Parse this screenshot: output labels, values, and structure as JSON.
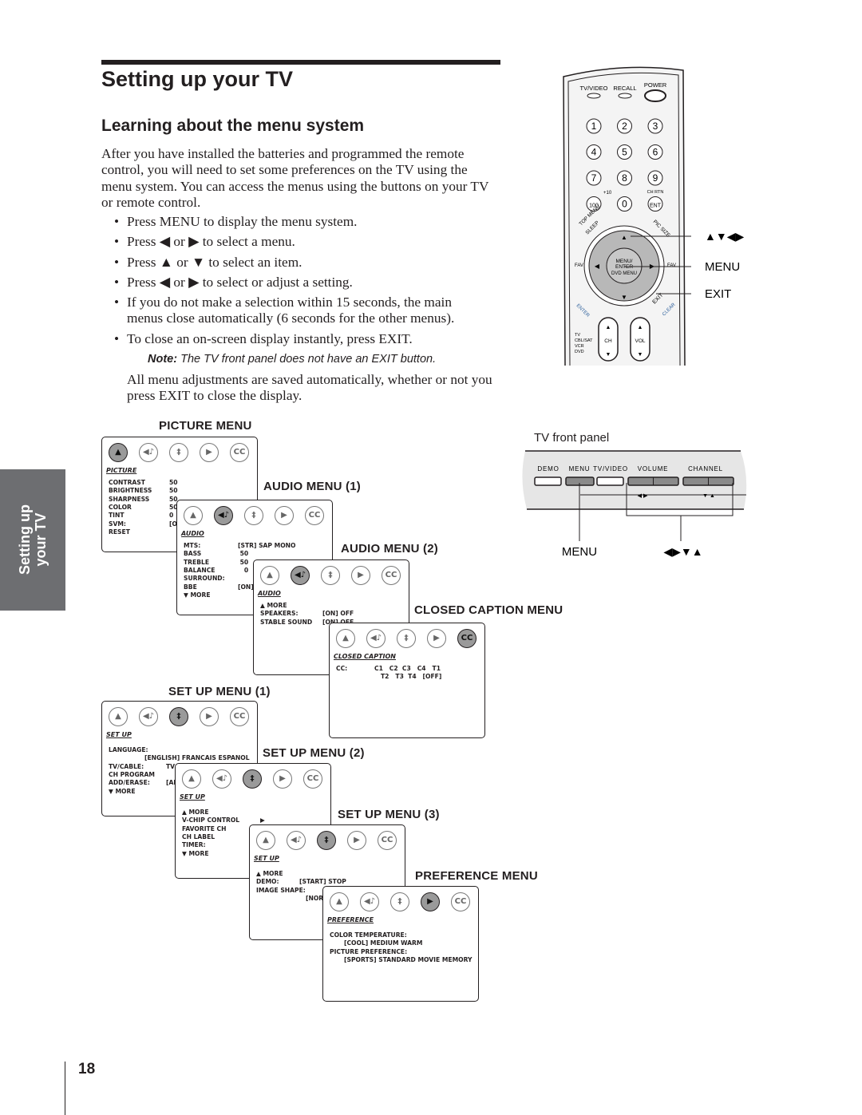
{
  "header": {
    "title": "Setting up your TV",
    "subtitle": "Learning about the menu system"
  },
  "intro": "After you have installed the batteries and programmed the remote control, you will need to set some preferences on the TV using the menu system. You can access the menus using the buttons on your TV or remote control.",
  "bullets": [
    "Press MENU to display the menu system.",
    "Press ◀ or ▶ to select a menu.",
    "Press ▲ or ▼ to select an item.",
    "Press ◀ or ▶ to select or adjust a setting.",
    "If you do not make a selection within 15 seconds, the main menus close automatically (6 seconds for the other menus).",
    "To close an on-screen display instantly, press EXIT."
  ],
  "note": {
    "label": "Note:",
    "text": " The TV front panel does not have an EXIT button."
  },
  "after": "All menu adjustments are saved automatically, whether or not you press EXIT to close the display.",
  "side_tab": {
    "line1": "Setting up",
    "line2": "your TV"
  },
  "page_number": "18",
  "menu_icons": [
    "picture-icon",
    "audio-icon",
    "setup-icon",
    "preference-icon",
    "closed-caption-icon"
  ],
  "menus": [
    {
      "title": "PICTURE MENU",
      "label": "PICTURE",
      "selected": 0,
      "rows": [
        {
          "label": "CONTRAST",
          "value": "50"
        },
        {
          "label": "BRIGHTNESS",
          "value": "50"
        },
        {
          "label": "SHARPNESS",
          "value": "50"
        },
        {
          "label": "COLOR",
          "value": "50"
        },
        {
          "label": "TINT",
          "value": "0"
        },
        {
          "label": "SVM:",
          "value": "[ON] OFF"
        },
        {
          "label": "RESET",
          "value": ""
        }
      ]
    },
    {
      "title": "AUDIO MENU (1)",
      "label": "AUDIO",
      "selected": 1,
      "rows": [
        {
          "label": "MTS:",
          "value": "[STR] SAP MONO"
        },
        {
          "label": "BASS",
          "value": " 50"
        },
        {
          "label": "TREBLE",
          "value": " 50"
        },
        {
          "label": "BALANCE",
          "value": "   0"
        },
        {
          "label": "SURROUND:",
          "value": ""
        },
        {
          "label": "BBE",
          "value": "[ON] OFF"
        },
        {
          "label": "▼ MORE",
          "value": ""
        }
      ]
    },
    {
      "title": "AUDIO MENU (2)",
      "label": "AUDIO",
      "selected": 1,
      "rows": [
        {
          "label": "▲ MORE",
          "value": ""
        },
        {
          "label": "SPEAKERS:",
          "value": "[ON] OFF"
        },
        {
          "label": "STABLE SOUND",
          "value": "[ON] OFF"
        }
      ]
    },
    {
      "title": "CLOSED CAPTION MENU",
      "label": "CLOSED CAPTION",
      "selected": 4,
      "rows": [
        {
          "label": "CC:",
          "value": "C1   C2  C3   C4   T1"
        },
        {
          "label": "",
          "value": "T2   T3  T4   [OFF]"
        }
      ]
    },
    {
      "title": "SET UP MENU (1)",
      "label": "SET UP",
      "selected": 2,
      "rows": [
        {
          "label": "LANGUAGE:",
          "value": ""
        },
        {
          "label": "",
          "value": "[ENGLISH] FRANCAIS ESPANOL"
        },
        {
          "label": "TV/CABLE:",
          "value": "TV [CABLE]"
        },
        {
          "label": "CH PROGRAM",
          "value": ""
        },
        {
          "label": "ADD/ERASE:",
          "value": "[ADD] ERASE"
        },
        {
          "label": "▼ MORE",
          "value": ""
        }
      ]
    },
    {
      "title": "SET UP MENU (2)",
      "label": "SET UP",
      "selected": 2,
      "rows": [
        {
          "label": "▲ MORE",
          "value": ""
        },
        {
          "label": "V-CHIP CONTROL",
          "value": "▶"
        },
        {
          "label": "FAVORITE CH",
          "value": "▶"
        },
        {
          "label": "CH LABEL",
          "value": ""
        },
        {
          "label": "TIMER:",
          "value": ""
        },
        {
          "label": "▼ MORE",
          "value": ""
        }
      ]
    },
    {
      "title": "SET UP MENU (3)",
      "label": "SET UP",
      "selected": 2,
      "rows": [
        {
          "label": "▲ MORE",
          "value": ""
        },
        {
          "label": "DEMO:",
          "value": "[START] STOP"
        },
        {
          "label": "IMAGE SHAPE:",
          "value": ""
        },
        {
          "label": "",
          "value": "[NORMAL]"
        }
      ]
    },
    {
      "title": "PREFERENCE MENU",
      "label": "PREFERENCE",
      "selected": 3,
      "rows": [
        {
          "label": "COLOR TEMPERATURE:",
          "value": ""
        },
        {
          "label": "",
          "value": "[COOL] MEDIUM WARM"
        },
        {
          "label": "PICTURE PREFERENCE:",
          "value": ""
        },
        {
          "label": "",
          "value": "[SPORTS] STANDARD MOVIE MEMORY"
        }
      ]
    }
  ],
  "remote": {
    "top_buttons": [
      "TV/VIDEO",
      "RECALL",
      "POWER"
    ],
    "digits": [
      "1",
      "2",
      "3",
      "4",
      "5",
      "6",
      "7",
      "8",
      "9",
      "100",
      "0",
      "ENT"
    ],
    "plus10": "+10",
    "chrtn": "CH RTN",
    "topmenu": "TOP MENU",
    "sleep": "SLEEP",
    "picsize": "PIC SIZE",
    "center": [
      "MENU/",
      "ENTER",
      "DVD MENU"
    ],
    "fav": "FAV",
    "enter": "ENTER",
    "exit": "EXIT",
    "clear": "CLEAR",
    "modes": [
      "TV",
      "CBL/SAT",
      "VCR",
      "DVD"
    ],
    "ch": "CH",
    "vol": "VOL",
    "callouts": [
      "▲▼◀▶",
      "MENU",
      "EXIT"
    ]
  },
  "front_panel": {
    "title": "TV front panel",
    "buttons": [
      "DEMO",
      "MENU",
      "TV/VIDEO",
      "VOLUME",
      "CHANNEL"
    ],
    "callouts": [
      "MENU",
      "◀▶▼▲"
    ]
  }
}
